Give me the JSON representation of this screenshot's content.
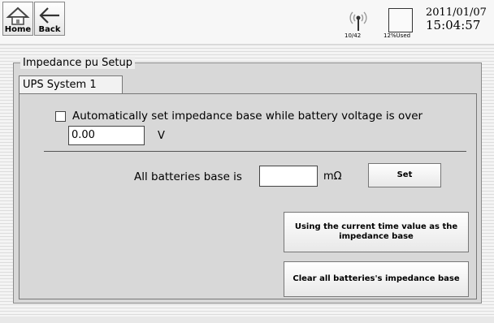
{
  "toolbar": {
    "home_label": "Home",
    "back_label": "Back"
  },
  "status": {
    "wifi_icon": "wifi-icon",
    "wifi_count": "10/42",
    "disk_icon": "disk-icon",
    "disk_used": "12%Used",
    "date": "2011/01/07",
    "time": "15:04:57"
  },
  "group": {
    "title": "Impedance pu Setup",
    "tab": "UPS System 1"
  },
  "auto": {
    "checked": false,
    "label": "Automatically set impedance base while battery voltage is over",
    "voltage_value": "0.00",
    "voltage_unit": "V"
  },
  "base": {
    "label": "All batteries base is",
    "value": "",
    "unit": "mΩ",
    "set_label": "Set"
  },
  "buttons": {
    "use_current_label": "Using the current time value as the impedance base",
    "clear_label": "Clear all batteries's impedance base"
  }
}
